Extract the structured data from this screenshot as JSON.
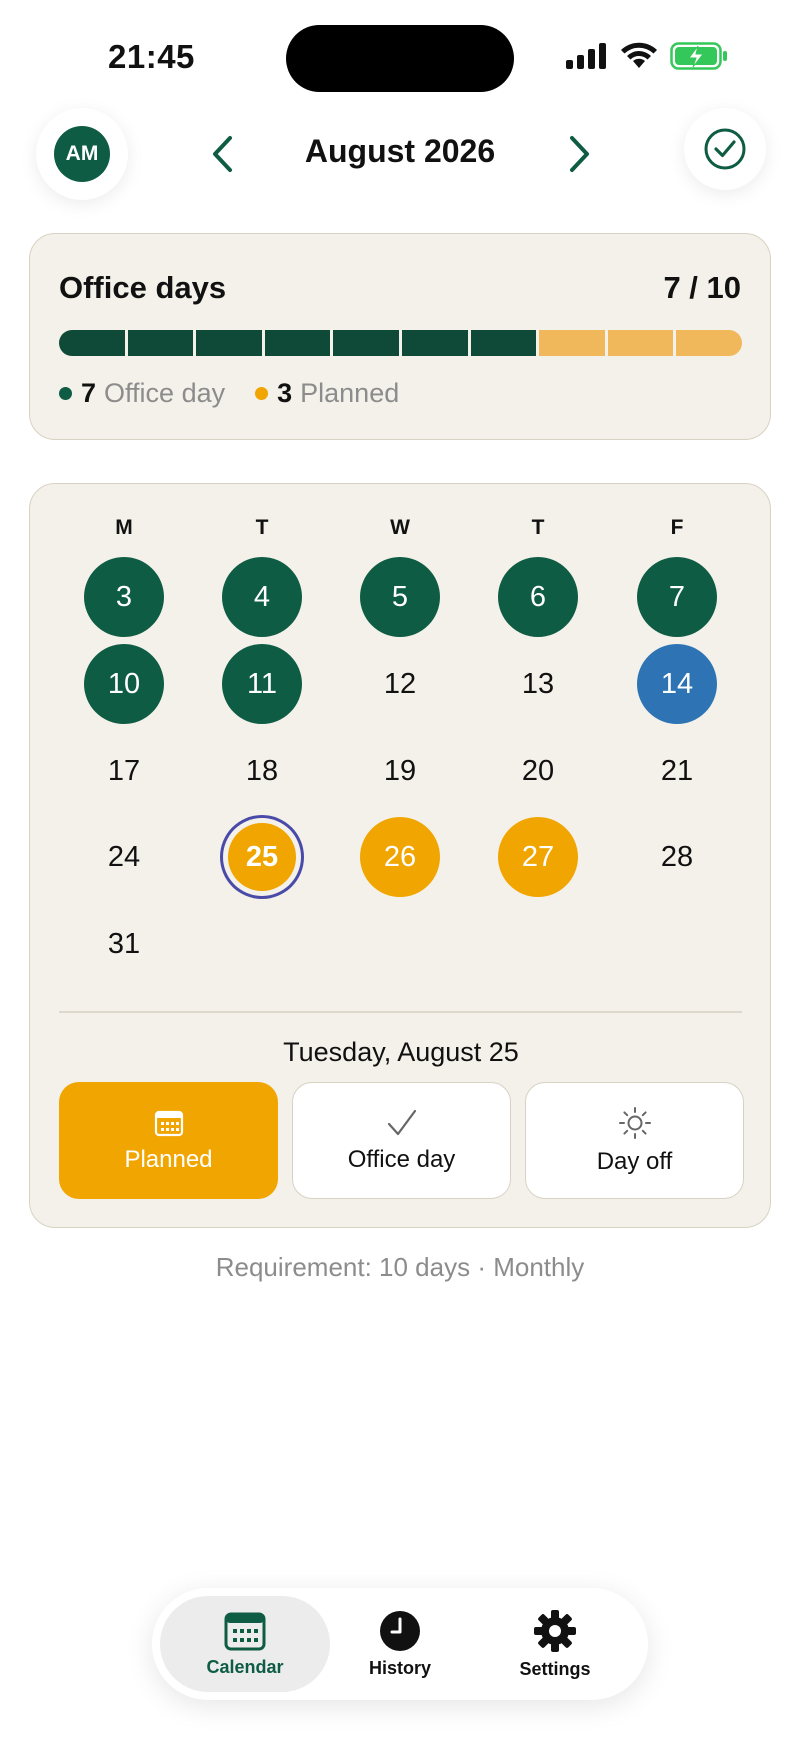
{
  "status_bar": {
    "time": "21:45"
  },
  "header": {
    "avatar_initials": "AM",
    "month_title": "August 2026"
  },
  "summary": {
    "title": "Office days",
    "count_text": "7 / 10",
    "progress": {
      "completed": 7,
      "planned": 3,
      "total": 10
    },
    "legend": [
      {
        "count": "7",
        "label": "Office day",
        "color": "#0f5c44"
      },
      {
        "count": "3",
        "label": "Planned",
        "color": "#f0a500"
      }
    ]
  },
  "calendar": {
    "weekdays": [
      "M",
      "T",
      "W",
      "T",
      "F"
    ],
    "weeks": [
      [
        {
          "day": "3",
          "status": "office"
        },
        {
          "day": "4",
          "status": "office"
        },
        {
          "day": "5",
          "status": "office"
        },
        {
          "day": "6",
          "status": "office"
        },
        {
          "day": "7",
          "status": "office"
        }
      ],
      [
        {
          "day": "10",
          "status": "office"
        },
        {
          "day": "11",
          "status": "office"
        },
        {
          "day": "12",
          "status": "none"
        },
        {
          "day": "13",
          "status": "none"
        },
        {
          "day": "14",
          "status": "dayoff"
        }
      ],
      [
        {
          "day": "17",
          "status": "none"
        },
        {
          "day": "18",
          "status": "none"
        },
        {
          "day": "19",
          "status": "none"
        },
        {
          "day": "20",
          "status": "none"
        },
        {
          "day": "21",
          "status": "none"
        }
      ],
      [
        {
          "day": "24",
          "status": "none"
        },
        {
          "day": "25",
          "status": "planned",
          "selected": true
        },
        {
          "day": "26",
          "status": "planned"
        },
        {
          "day": "27",
          "status": "planned"
        },
        {
          "day": "28",
          "status": "none"
        }
      ],
      [
        {
          "day": "31",
          "status": "none"
        }
      ]
    ],
    "selected_date": "Tuesday, August 25",
    "actions": [
      {
        "label": "Planned",
        "icon": "calendar-icon",
        "active": true
      },
      {
        "label": "Office day",
        "icon": "checkmark-icon",
        "active": false
      },
      {
        "label": "Day off",
        "icon": "sun-icon",
        "active": false
      }
    ]
  },
  "requirement": "Requirement: 10 days · Monthly",
  "tabs": [
    {
      "label": "Calendar",
      "icon": "calendar-icon",
      "active": true
    },
    {
      "label": "History",
      "icon": "clock-icon",
      "active": false
    },
    {
      "label": "Settings",
      "icon": "gear-icon",
      "active": false
    }
  ],
  "colors": {
    "office": "#0f5c44",
    "office_progress": "#0e4a37",
    "planned": "#f0a500",
    "planned_progress": "#f0b85a",
    "dayoff": "#2e74b5",
    "selected_ring": "#4a4aa8"
  }
}
